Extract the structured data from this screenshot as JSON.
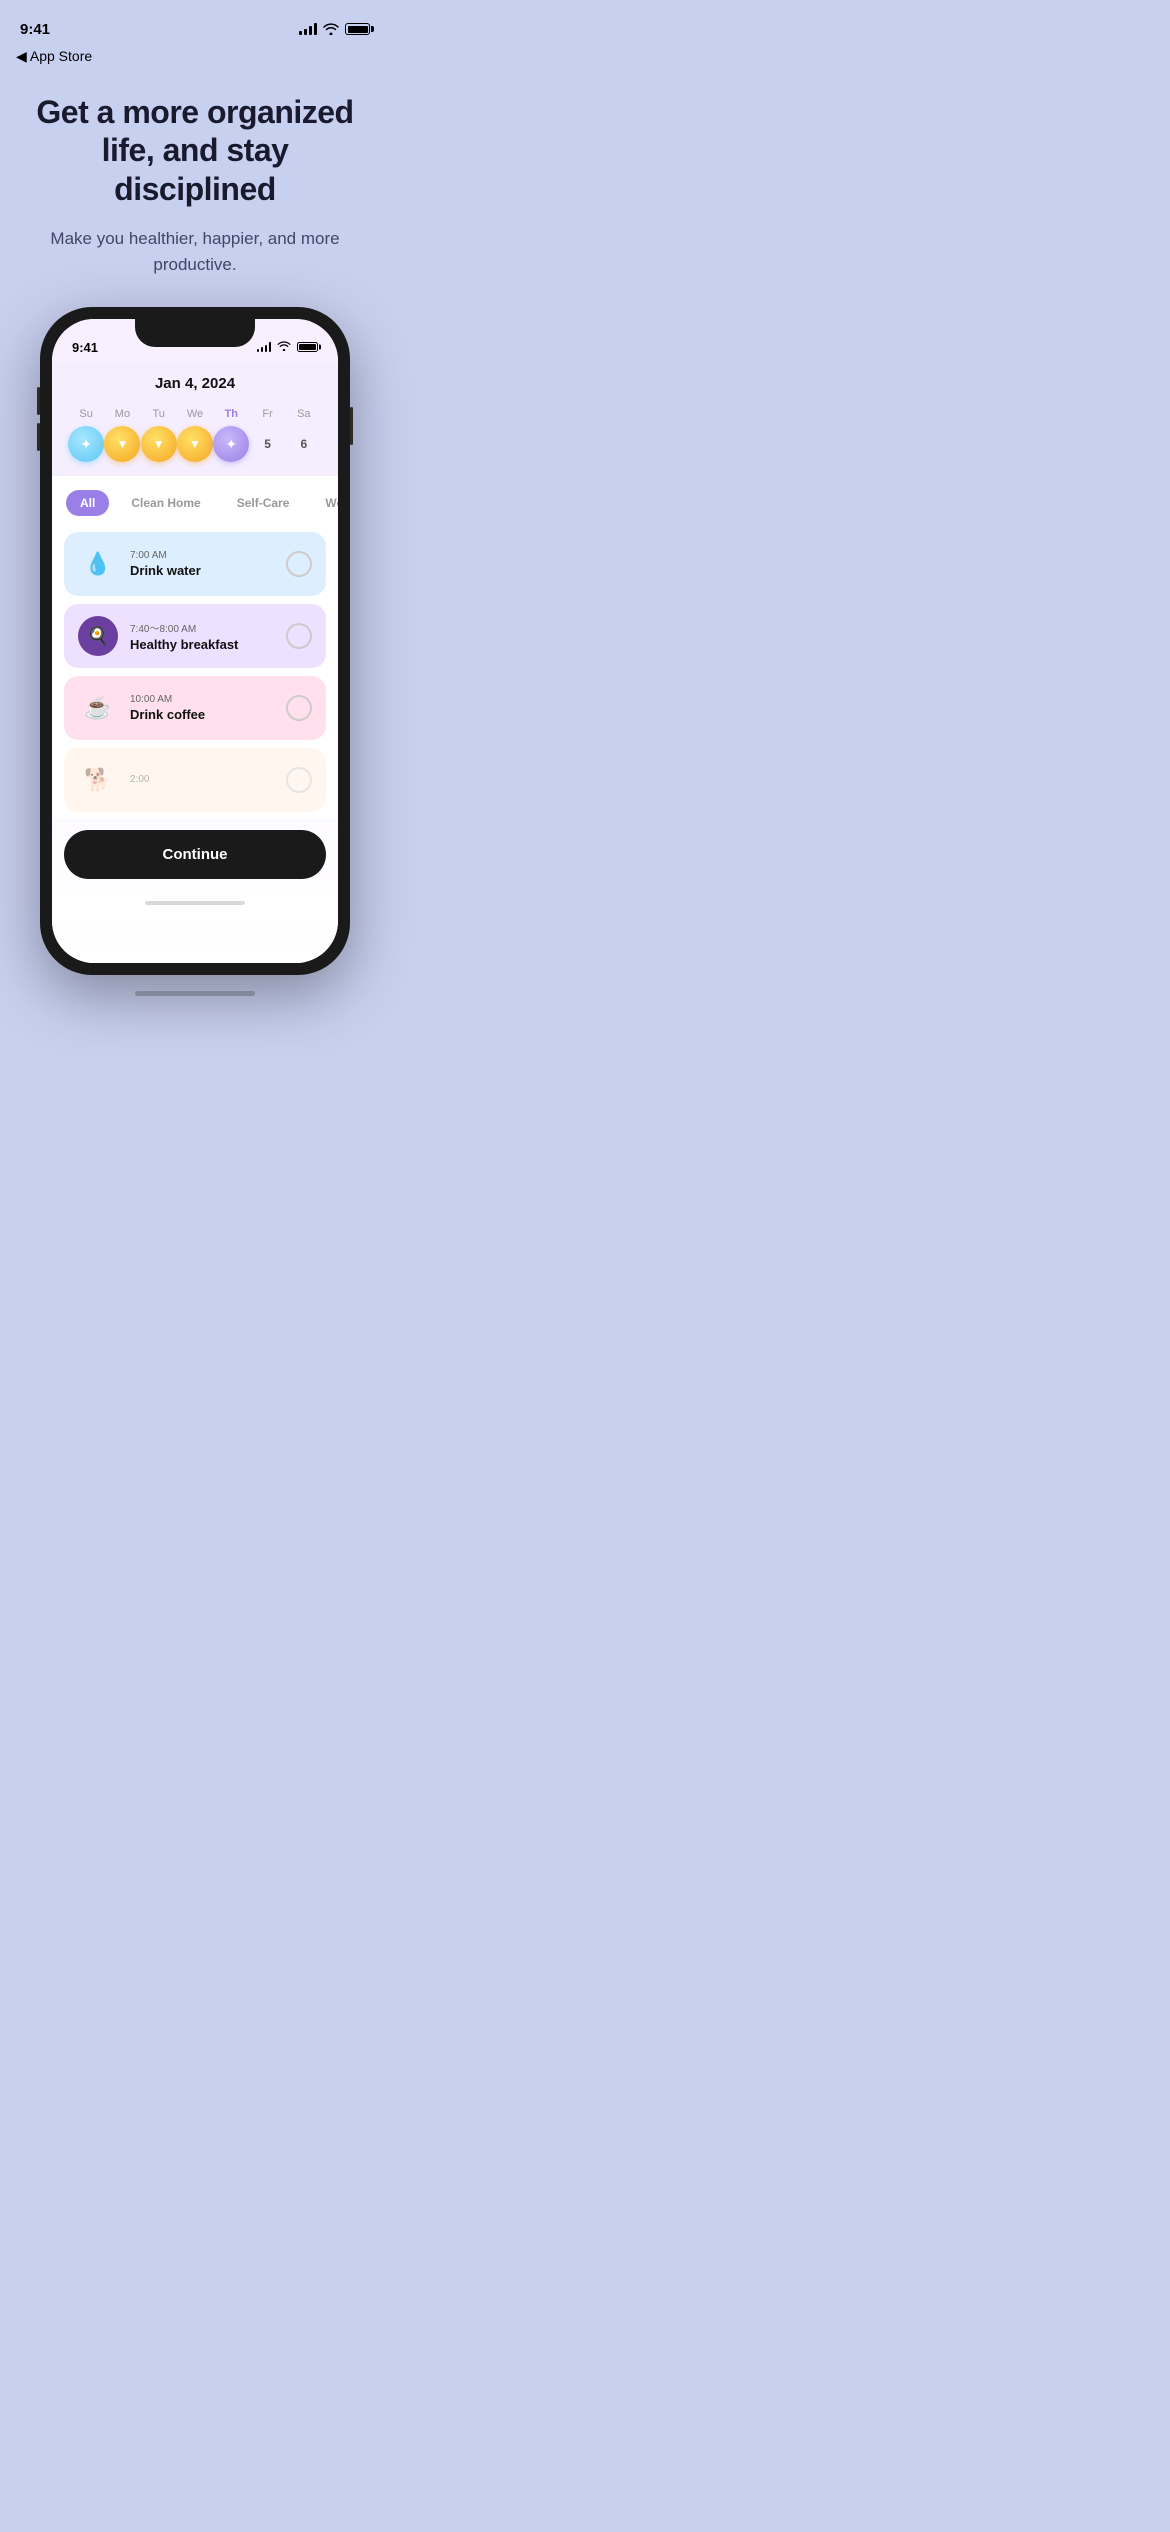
{
  "status_bar": {
    "time": "9:41",
    "back_label": "◀ App Store"
  },
  "hero": {
    "title": "Get a more organized life, and stay disciplined",
    "subtitle": "Make you healthier, happier, and more productive."
  },
  "phone": {
    "inner_time": "9:41",
    "date": "Jan 4, 2024",
    "calendar": {
      "days": [
        {
          "label": "Su",
          "type": "coin-blue",
          "icon": "✦"
        },
        {
          "label": "Mo",
          "type": "coin-gold",
          "icon": "▼"
        },
        {
          "label": "Tu",
          "type": "coin-gold",
          "icon": "▼"
        },
        {
          "label": "We",
          "type": "coin-gold",
          "icon": "▼"
        },
        {
          "label": "Th",
          "type": "coin-active",
          "icon": "✦"
        },
        {
          "label": "Fr",
          "type": "number",
          "value": "5"
        },
        {
          "label": "Sa",
          "type": "number",
          "value": "6"
        }
      ]
    },
    "category_tabs": [
      {
        "label": "All",
        "active": true
      },
      {
        "label": "Clean Home",
        "active": false
      },
      {
        "label": "Self-Care",
        "active": false
      },
      {
        "label": "Work",
        "active": false
      }
    ],
    "tasks": [
      {
        "time": "7:00 AM",
        "name": "Drink water",
        "icon": "💧",
        "bg": "blue-bg"
      },
      {
        "time": "7:40～8:00 AM",
        "name": "Healthy breakfast",
        "icon": "🍳",
        "bg": "purple-bg"
      },
      {
        "time": "10:00 AM",
        "name": "Drink coffee",
        "icon": "☕",
        "bg": "pink-bg"
      },
      {
        "time": "2:00",
        "name": "",
        "icon": "🐕",
        "bg": "peach-bg",
        "partial": true
      }
    ],
    "continue_label": "Continue"
  }
}
